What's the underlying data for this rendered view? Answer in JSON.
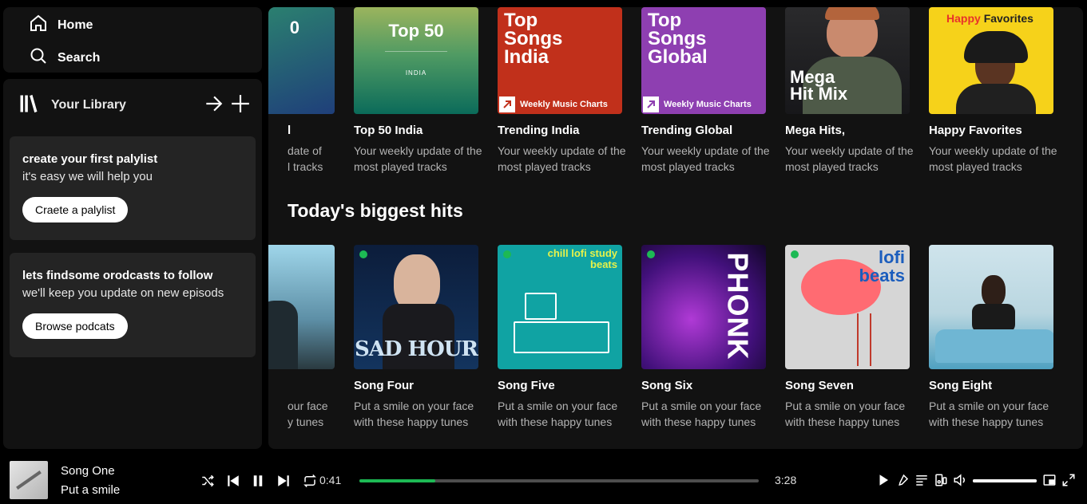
{
  "nav": {
    "home": "Home",
    "search": "Search"
  },
  "library": {
    "title": "Your Library",
    "playlist_card": {
      "title": "create your first palylist",
      "subtitle": "it's easy we will help you",
      "button": "Craete a palylist"
    },
    "podcast_card": {
      "title": "lets findsome orodcasts to follow",
      "subtitle": "we'll keep you update on new episods",
      "button": "Browse podcats"
    }
  },
  "top_row": {
    "partial": {
      "cover_text": "0",
      "title": "l",
      "desc1": "date of",
      "desc2": "l tracks"
    },
    "cards": [
      {
        "title": "Top 50 India",
        "cover_title": "Top 50",
        "cover_sub": "INDIA",
        "desc": "Your weekly update of the most played tracks"
      },
      {
        "title": "Trending India",
        "cover_title": "Top Songs India",
        "cover_band": "Weekly Music Charts",
        "desc": "Your weekly update of the most played tracks"
      },
      {
        "title": "Trending Global",
        "cover_title": "Top Songs Global",
        "cover_band": "Weekly Music Charts",
        "desc": "Your weekly update of the most played tracks"
      },
      {
        "title": "Mega Hits,",
        "cover_title": "Mega Hit Mix",
        "desc": "Your weekly update of the most played tracks"
      },
      {
        "title": "Happy Favorites",
        "cover_title_a": "Happy",
        "cover_title_b": "Favorites",
        "desc": "Your weekly update of the most played tracks"
      }
    ]
  },
  "section": {
    "title": "Today's biggest hits"
  },
  "hits_row": {
    "partial": {
      "desc1": "our face",
      "desc2": "y tunes"
    },
    "cards": [
      {
        "title": "Song Four",
        "cover_text": "SAD HOUR",
        "desc": "Put a smile on your face with these happy tunes"
      },
      {
        "title": "Song Five",
        "cover_text": "chill lofi study beats",
        "desc": "Put a smile on your face with these happy tunes"
      },
      {
        "title": "Song Six",
        "cover_text": "PHONK",
        "desc": "Put a smile on your face with these happy tunes"
      },
      {
        "title": "Song Seven",
        "cover_text": "lofi beats",
        "desc": "Put a smile on your face with these happy tunes"
      },
      {
        "title": "Song Eight",
        "desc": "Put a smile on your face with these happy tunes"
      }
    ]
  },
  "player": {
    "title": "Song One",
    "artist": "Put a smile",
    "elapsed": "0:41",
    "duration": "3:28",
    "progress": 0.19,
    "volume": 1.0
  },
  "colors": {
    "accent": "#1db954",
    "surface": "#121212",
    "card": "#242424"
  }
}
